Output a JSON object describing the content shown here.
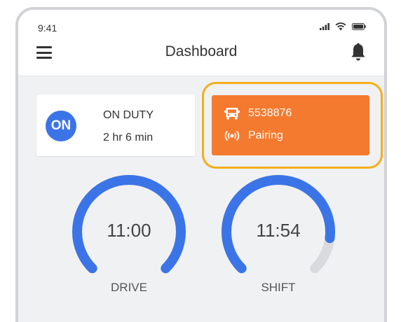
{
  "statusbar": {
    "time": "9:41",
    "icons": [
      "signal-icon",
      "wifi-icon",
      "battery-icon"
    ]
  },
  "header": {
    "title": "Dashboard",
    "menu_icon": "hamburger-menu-icon",
    "bell_icon": "bell-icon"
  },
  "duty": {
    "badge": "ON",
    "status": "ON DUTY",
    "elapsed": "2 hr 6 min"
  },
  "vehicle": {
    "number": "5538876",
    "status": "Pairing",
    "icons": [
      "truck-icon",
      "broadcast-icon"
    ]
  },
  "gauges": [
    {
      "value": "11:00",
      "label": "DRIVE",
      "fill_fraction": 1.0
    },
    {
      "value": "11:54",
      "label": "SHIFT",
      "fill_fraction": 0.86
    }
  ],
  "colors": {
    "accent_blue": "#3b74e6",
    "vehicle_orange": "#f47a2f",
    "highlight_amber": "#f4ae1b",
    "gauge_track": "#d9dadd"
  }
}
